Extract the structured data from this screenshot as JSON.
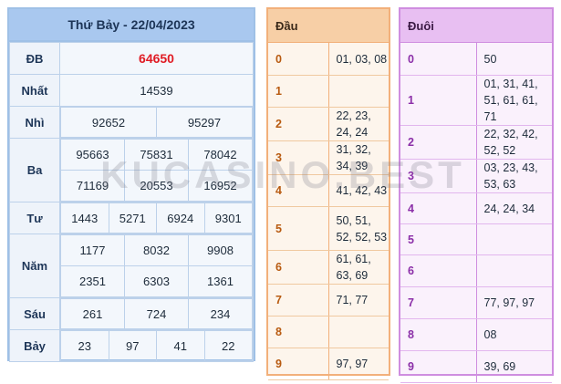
{
  "results": {
    "title": "Thứ Bảy - 22/04/2023",
    "rows": [
      {
        "label": "ĐB",
        "values": [
          "64650"
        ]
      },
      {
        "label": "Nhất",
        "values": [
          "14539"
        ]
      },
      {
        "label": "Nhì",
        "values": [
          "92652",
          "95297"
        ]
      },
      {
        "label": "Ba",
        "values": [
          "95663",
          "75831",
          "78042",
          "71169",
          "20553",
          "16952"
        ]
      },
      {
        "label": "Tư",
        "values": [
          "1443",
          "5271",
          "6924",
          "9301"
        ]
      },
      {
        "label": "Năm",
        "values": [
          "1177",
          "8032",
          "9908",
          "2351",
          "6303",
          "1361"
        ]
      },
      {
        "label": "Sáu",
        "values": [
          "261",
          "724",
          "234"
        ]
      },
      {
        "label": "Bảy",
        "values": [
          "23",
          "97",
          "41",
          "22"
        ]
      }
    ]
  },
  "dau": {
    "header": "Đầu",
    "rows": [
      {
        "k": "0",
        "v": "01, 03, 08"
      },
      {
        "k": "1",
        "v": ""
      },
      {
        "k": "2",
        "v": "22, 23, 24, 24"
      },
      {
        "k": "3",
        "v": "31, 32, 34, 39"
      },
      {
        "k": "4",
        "v": "41, 42, 43"
      },
      {
        "k": "5",
        "v": "50, 51, 52, 52, 53"
      },
      {
        "k": "6",
        "v": "61, 61, 63, 69"
      },
      {
        "k": "7",
        "v": "71, 77"
      },
      {
        "k": "8",
        "v": ""
      },
      {
        "k": "9",
        "v": "97, 97"
      }
    ]
  },
  "duoi": {
    "header": "Đuôi",
    "rows": [
      {
        "k": "0",
        "v": "50"
      },
      {
        "k": "1",
        "v": "01, 31, 41, 51, 61, 61, 71"
      },
      {
        "k": "2",
        "v": "22, 32, 42, 52, 52"
      },
      {
        "k": "3",
        "v": "03, 23, 43, 53, 63"
      },
      {
        "k": "4",
        "v": "24, 24, 34"
      },
      {
        "k": "5",
        "v": ""
      },
      {
        "k": "6",
        "v": ""
      },
      {
        "k": "7",
        "v": "77, 97, 97"
      },
      {
        "k": "8",
        "v": "08"
      },
      {
        "k": "9",
        "v": "39, 69"
      }
    ]
  },
  "watermark": "KUCASINO.BEST",
  "colors": {
    "special": "#e01b24",
    "results_header": "#a9c8ef",
    "dau_header": "#f7cfa6",
    "duoi_header": "#e8bff2"
  }
}
